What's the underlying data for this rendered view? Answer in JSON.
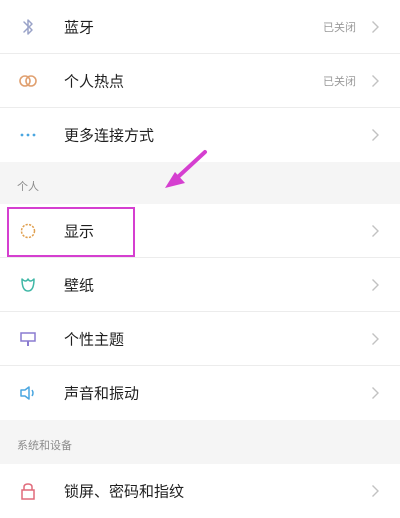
{
  "colors": {
    "highlight": "#d53fd0",
    "arrow": "#d53fd0",
    "bluetooth_icon": "#9aa3c8",
    "hotspot_icon": "#e0a070",
    "more_icon": "#4aa6e0",
    "display_icon": "#e0a050",
    "wallpaper_icon": "#3fb7a6",
    "theme_icon": "#8a7bd0",
    "sound_icon": "#4aa6e0",
    "lock_icon": "#e06a7a"
  },
  "connectivity": {
    "items": [
      {
        "label": "蓝牙",
        "status": "已关闭",
        "icon": "bluetooth-icon"
      },
      {
        "label": "个人热点",
        "status": "已关闭",
        "icon": "hotspot-icon"
      },
      {
        "label": "更多连接方式",
        "status": "",
        "icon": "more-dots-icon"
      }
    ]
  },
  "personal": {
    "header": "个人",
    "items": [
      {
        "label": "显示",
        "icon": "brightness-icon"
      },
      {
        "label": "壁纸",
        "icon": "wallpaper-icon"
      },
      {
        "label": "个性主题",
        "icon": "theme-icon"
      },
      {
        "label": "声音和振动",
        "icon": "speaker-icon"
      }
    ]
  },
  "system": {
    "header": "系统和设备",
    "items": [
      {
        "label": "锁屏、密码和指纹",
        "icon": "lock-icon"
      }
    ]
  }
}
